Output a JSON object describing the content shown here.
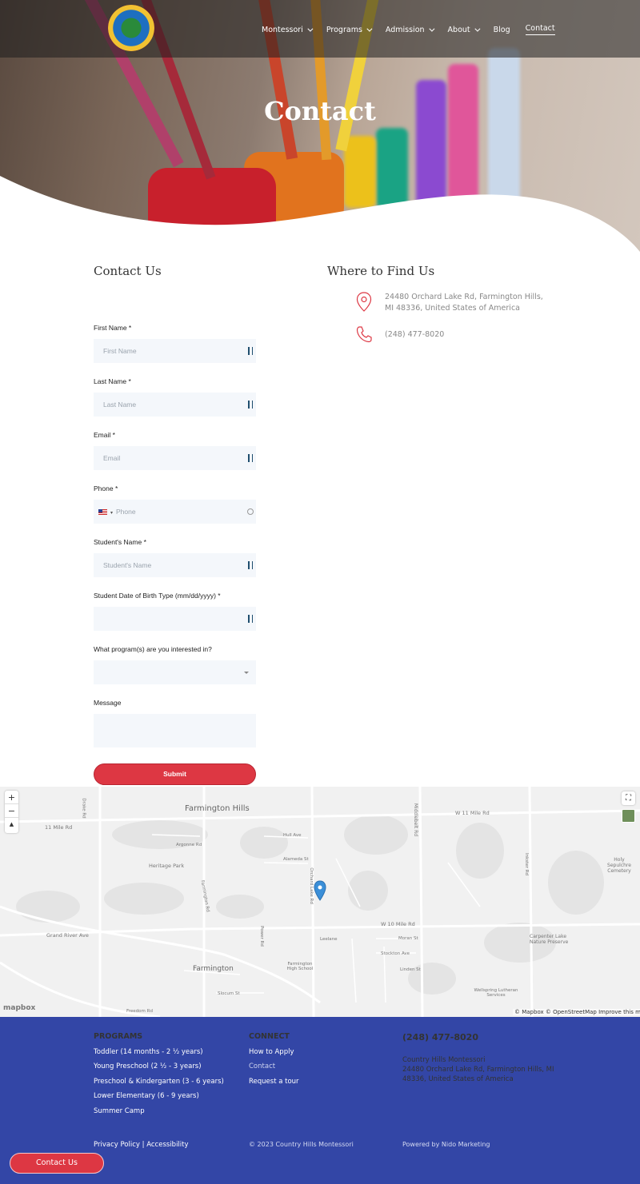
{
  "header": {
    "nav": [
      {
        "label": "Montessori",
        "dropdown": true
      },
      {
        "label": "Programs",
        "dropdown": true
      },
      {
        "label": "Admission",
        "dropdown": true
      },
      {
        "label": "About",
        "dropdown": true
      },
      {
        "label": "Blog",
        "dropdown": false
      },
      {
        "label": "Contact",
        "dropdown": false,
        "active": true
      }
    ],
    "logo_icon": "school-globe-logo"
  },
  "hero": {
    "title": "Contact"
  },
  "contact_form": {
    "title": "Contact Us",
    "fields": {
      "first_name": {
        "label": "First Name *",
        "placeholder": "First Name"
      },
      "last_name": {
        "label": "Last Name *",
        "placeholder": "Last Name"
      },
      "email": {
        "label": "Email *",
        "placeholder": "Email"
      },
      "phone": {
        "label": "Phone *",
        "placeholder": "Phone"
      },
      "student_name": {
        "label": "Student's Name *",
        "placeholder": "Student's Name"
      },
      "dob": {
        "label": "Student Date of Birth Type (mm/dd/yyyy) *",
        "placeholder": ""
      },
      "program": {
        "label": "What program(s) are you interested in?",
        "value": ""
      },
      "message": {
        "label": "Message",
        "placeholder": ""
      }
    },
    "submit_label": "Submit"
  },
  "find_us": {
    "title": "Where to Find Us",
    "address": "24480 Orchard Lake Rd, Farmington Hills, MI 48336, United States of America",
    "phone": "(248) 477-8020",
    "address_icon": "map-pin-icon",
    "phone_icon": "phone-icon"
  },
  "map": {
    "zoom_in": "+",
    "zoom_out": "−",
    "compass": "▲",
    "labels": {
      "farmington_hills": "Farmington Hills",
      "farmington": "Farmington",
      "mile11": "11 Mile Rd",
      "w11": "W 11 Mile Rd",
      "w10": "W 10 Mile Rd",
      "grand_river": "Grand River Ave",
      "middlebelt": "Middlebelt Rd",
      "orchard": "Orchard Lake Rd",
      "farmington_rd": "Farmington Rd",
      "heritage": "Heritage Park",
      "holy": "Holy Sepulchre Cemetery",
      "carpenter": "Carpenter Lake Nature Preserve",
      "fhs": "Farmington High School",
      "wellspring": "Wellspring Lutheran Services",
      "drake": "Drake Rd",
      "inkster": "Inkster Rd",
      "hull": "Hull Ave",
      "alameda": "Alameda St",
      "leelane": "Leelane",
      "stockton": "Stockton Ave",
      "moran": "Moran St",
      "linden": "Linden St",
      "argonne": "Argonne Rd",
      "freedom": "Freedom Rd",
      "slocum": "Slocum St",
      "power": "Power Rd"
    },
    "attribution": "© Mapbox © OpenStreetMap",
    "improve": "Improve this map",
    "logo_text": "mapbox"
  },
  "footer": {
    "programs": {
      "heading": "PROGRAMS",
      "links": [
        "Toddler (14 months - 2 ½ years)",
        "Young Preschool (2 ½ - 3 years)",
        "Preschool & Kindergarten (3 - 6 years)",
        "Lower Elementary (6 - 9 years)",
        "Summer Camp"
      ]
    },
    "connect": {
      "heading": "CONNECT",
      "links": [
        "How to Apply",
        "Contact",
        "Request a tour"
      ]
    },
    "contact": {
      "phone": "(248) 477-8020",
      "name": "Country Hills Montessori",
      "address": "24480 Orchard Lake Rd, Farmington Hills, MI 48336, United States of America"
    },
    "privacy": "Privacy Policy",
    "separator": "|",
    "accessibility": "Accessibility",
    "copyright": "© 2023 Country Hills Montessori",
    "powered": "Powered by Nido Marketing"
  },
  "floating_button": "Contact Us",
  "colors": {
    "accent": "#dd3743",
    "footer": "#3346a6"
  }
}
